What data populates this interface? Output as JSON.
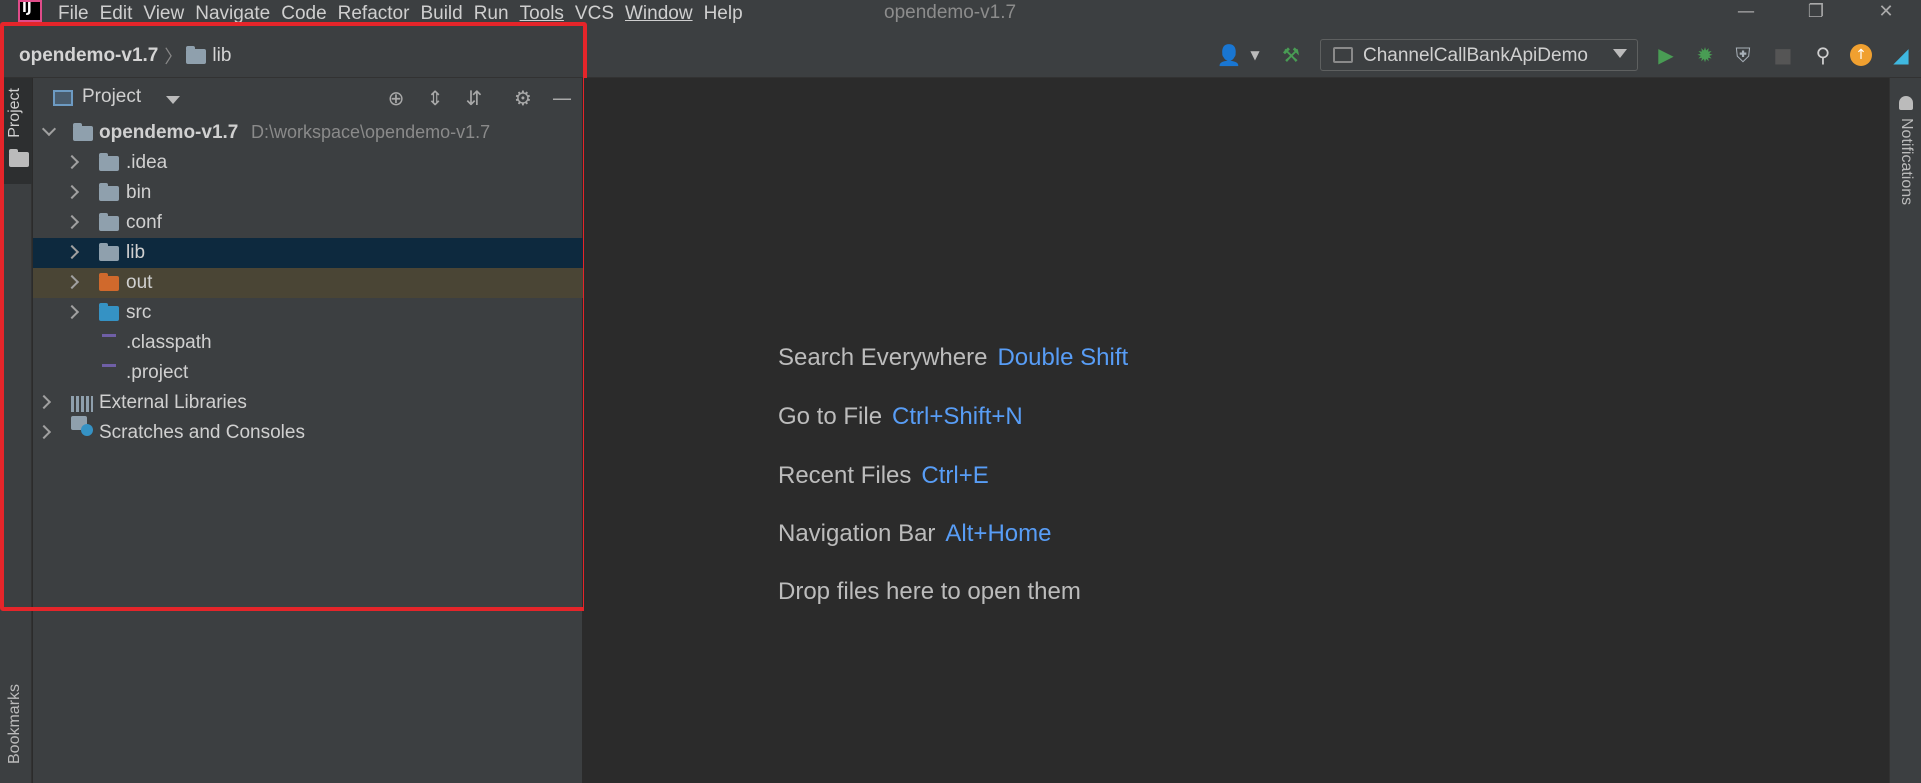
{
  "menu": {
    "items": [
      "File",
      "Edit",
      "View",
      "Navigate",
      "Code",
      "Refactor",
      "Build",
      "Run",
      "Tools",
      "VCS",
      "Window",
      "Help"
    ]
  },
  "window": {
    "title": "opendemo-v1.7",
    "minimize_icon": "minimize-icon",
    "restore_icon": "restore-icon",
    "close_icon": "close-icon"
  },
  "breadcrumb": {
    "project": "opendemo-v1.7",
    "folder": "lib"
  },
  "toolbar": {
    "run_config": "ChannelCallBankApiDemo",
    "icons": [
      "user-icon",
      "build-hammer-icon",
      "run-icon",
      "debug-icon",
      "coverage-icon",
      "stop-icon",
      "search-icon",
      "update-icon",
      "jetbrains-icon"
    ],
    "colors": {
      "run": "#499c54",
      "debug": "#499c54",
      "update": "#f0a030"
    }
  },
  "left_strip": {
    "project_tab": "Project",
    "bookmarks_tab": "Bookmarks"
  },
  "right_strip": {
    "notifications_tab": "Notifications"
  },
  "project_panel": {
    "title": "Project",
    "header_icons": [
      "locate-icon",
      "expand-all-icon",
      "collapse-all-icon",
      "gear-icon",
      "hide-icon"
    ],
    "tree": [
      {
        "label": "opendemo-v1.7",
        "path": "D:\\workspace\\opendemo-v1.7",
        "depth": 0,
        "expanded": true,
        "icon": "module-folder-icon"
      },
      {
        "label": ".idea",
        "depth": 1,
        "expanded": false,
        "icon": "folder-icon"
      },
      {
        "label": "bin",
        "depth": 1,
        "expanded": false,
        "icon": "folder-icon"
      },
      {
        "label": "conf",
        "depth": 1,
        "expanded": false,
        "icon": "folder-icon"
      },
      {
        "label": "lib",
        "depth": 1,
        "expanded": false,
        "icon": "folder-icon",
        "selected": true
      },
      {
        "label": "out",
        "depth": 1,
        "expanded": false,
        "icon": "excluded-folder-icon",
        "excluded": true
      },
      {
        "label": "src",
        "depth": 1,
        "expanded": false,
        "icon": "source-folder-icon"
      },
      {
        "label": ".classpath",
        "depth": 1,
        "icon": "file-icon"
      },
      {
        "label": ".project",
        "depth": 1,
        "icon": "file-icon"
      },
      {
        "label": "External Libraries",
        "depth": 0,
        "expanded": false,
        "icon": "libraries-icon"
      },
      {
        "label": "Scratches and Consoles",
        "depth": 0,
        "expanded": false,
        "icon": "scratches-icon"
      }
    ],
    "colors": {
      "folder": "#8fa0ad",
      "excluded_folder": "#d0692c",
      "source_folder": "#3592c4",
      "selected_row": "#0d293e",
      "excluded_row": "#4a4535"
    }
  },
  "editor": {
    "hints": [
      {
        "label": "Search Everywhere",
        "key": "Double Shift"
      },
      {
        "label": "Go to File",
        "key": "Ctrl+Shift+N"
      },
      {
        "label": "Recent Files",
        "key": "Ctrl+E"
      },
      {
        "label": "Navigation Bar",
        "key": "Alt+Home"
      },
      {
        "label": "Drop files here to open them",
        "key": ""
      }
    ]
  }
}
